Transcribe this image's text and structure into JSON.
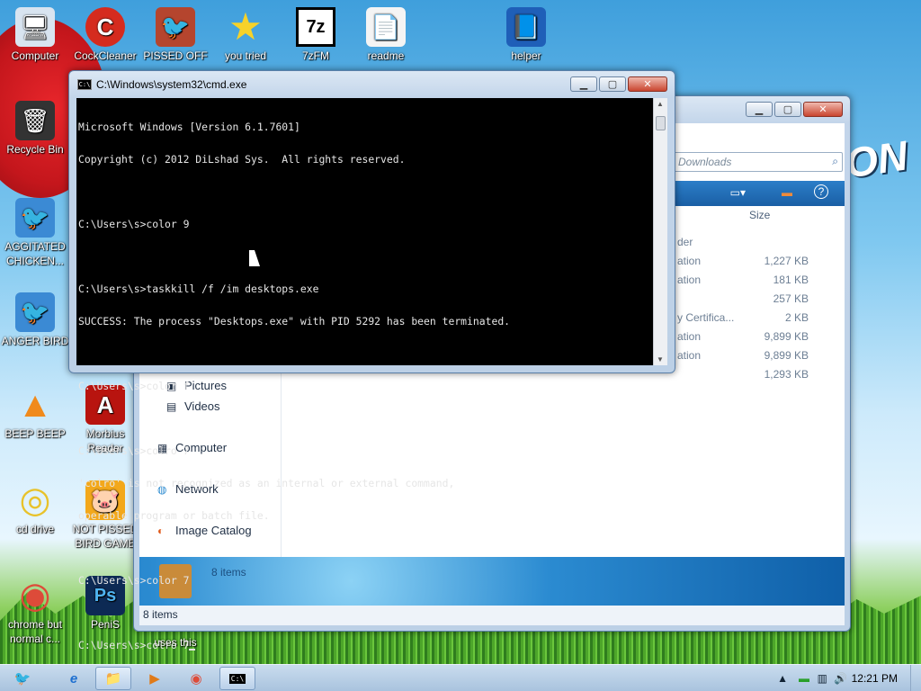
{
  "desktop_icons": [
    {
      "label": "Computer",
      "icon": "computer-icon",
      "glyph": "🖥"
    },
    {
      "label": "CockCleaner",
      "icon": "ccleaner-icon",
      "glyph": "C"
    },
    {
      "label": "PISSED OFF",
      "icon": "pissed-off-game-icon",
      "glyph": "🐦"
    },
    {
      "label": "you tried",
      "icon": "star-icon",
      "glyph": "★"
    },
    {
      "label": "7zFM",
      "icon": "7zip-icon",
      "glyph": "7z"
    },
    {
      "label": "readme",
      "icon": "document-icon",
      "glyph": "📄"
    },
    {
      "label": "helper",
      "icon": "book-icon",
      "glyph": "📘"
    },
    {
      "label": "Recycle Bin",
      "icon": "recycle-bin-icon",
      "glyph": "🗑"
    },
    {
      "label": "AGGITATED CHICKEN...",
      "icon": "angry-bird-icon",
      "glyph": "🐦"
    },
    {
      "label": "ANGER BIRD",
      "icon": "angry-bird-icon",
      "glyph": "🐦"
    },
    {
      "label": "BEEP BEEP",
      "icon": "vlc-cone-icon",
      "glyph": "▲"
    },
    {
      "label": "Morbius Reader",
      "icon": "pdf-reader-icon",
      "glyph": "A"
    },
    {
      "label": "cd drive",
      "icon": "cd-drive-icon",
      "glyph": "◎"
    },
    {
      "label": "NOT PISSED BIRD GAME",
      "icon": "pig-game-icon",
      "glyph": "🐷"
    },
    {
      "label": "chrome but normal c...",
      "icon": "chrome-icon",
      "glyph": "◉"
    },
    {
      "label": "PeniS",
      "icon": "photoshop-icon",
      "glyph": "Ps"
    },
    {
      "label": "uses this",
      "icon": "shortcut-icon",
      "glyph": ""
    }
  ],
  "wallpaper": {
    "text": "ON"
  },
  "cmd": {
    "title": "C:\\Windows\\system32\\cmd.exe",
    "lines": [
      "Microsoft Windows [Version 6.1.7601]",
      "Copyright (c) 2012 DiLshad Sys.  All rights reserved.",
      "",
      "C:\\Users\\s>color 9",
      "",
      "C:\\Users\\s>taskkill /f /im desktops.exe",
      "SUCCESS: The process \"Desktops.exe\" with PID 5292 has been terminated.",
      "",
      "C:\\Users\\s>color f",
      "",
      "C:\\Users\\s>colro 7",
      "'colro' is not recognized as an internal or external command,",
      "operable program or batch file.",
      "",
      "C:\\Users\\s>color 7",
      "",
      "C:\\Users\\s>colro 7"
    ]
  },
  "explorer": {
    "search_placeholder": "Downloads",
    "size_header": "Size",
    "type_fragments": [
      "der",
      "ation",
      "ation",
      "",
      "y Certifica...",
      "ation",
      "ation",
      ""
    ],
    "sizes": [
      "",
      "1,227 KB",
      "181 KB",
      "257 KB",
      "2 KB",
      "9,899 KB",
      "9,899 KB",
      "1,293 KB"
    ],
    "nav": [
      {
        "label": "Pictures",
        "icon": "pictures-icon",
        "glyph": "▣"
      },
      {
        "label": "Videos",
        "icon": "videos-icon",
        "glyph": "▤"
      },
      {
        "label": "Computer",
        "icon": "computer-icon",
        "glyph": "▦"
      },
      {
        "label": "Network",
        "icon": "network-icon",
        "glyph": "◍"
      },
      {
        "label": "Image Catalog",
        "icon": "image-catalog-icon",
        "glyph": "◐"
      }
    ],
    "details_items": "8 items",
    "status_items": "8 items"
  },
  "taskbar": {
    "clock": "12:21 PM",
    "buttons": [
      {
        "icon": "start-angry-bird-icon",
        "glyph": "🐦"
      },
      {
        "icon": "internet-explorer-icon",
        "glyph": "e"
      },
      {
        "icon": "folder-icon",
        "glyph": "📁"
      },
      {
        "icon": "media-player-icon",
        "glyph": "▶"
      },
      {
        "icon": "chrome-icon",
        "glyph": "◉"
      },
      {
        "icon": "cmd-icon",
        "glyph": "C:\\"
      }
    ]
  }
}
